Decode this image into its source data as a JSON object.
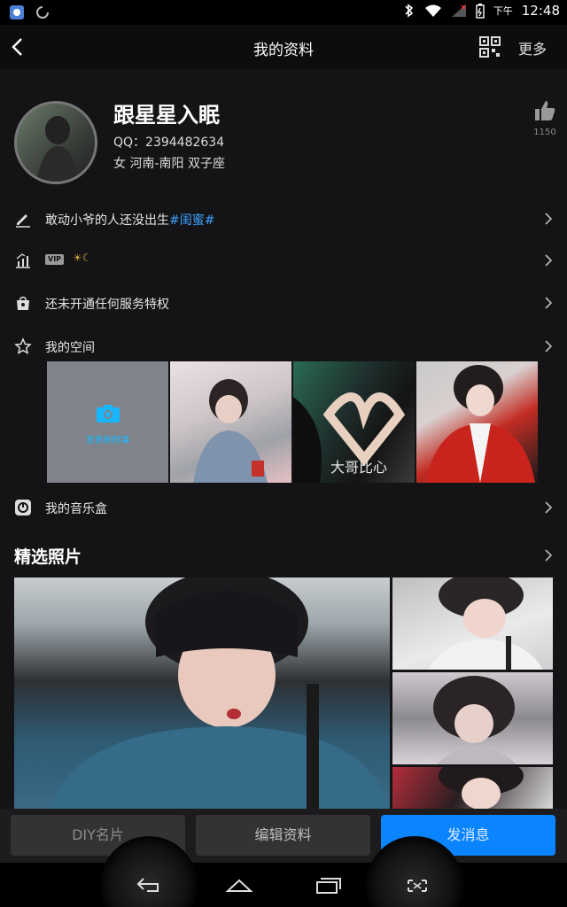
{
  "status_bar": {
    "time": "12:48",
    "ampm": "下午"
  },
  "nav": {
    "title": "我的资料",
    "more_label": "更多"
  },
  "profile": {
    "nickname": "跟星星入眠",
    "qq": "QQ：2394482634",
    "info": "女  河南-南阳  双子座",
    "like_count": "1150"
  },
  "rows": {
    "signature_prefix": "敢动小爷的人还没出生",
    "signature_tag": "#闺蜜#",
    "level_badge": "VIP",
    "level_icons": "☀☾",
    "service": "还未开通任何服务特权",
    "space": "我的空间",
    "music": "我的音乐盒"
  },
  "space": {
    "post_label": "发表新鲜事",
    "tile3_caption": "大哥比心"
  },
  "featured": {
    "title": "精选照片"
  },
  "actions": {
    "diy": "DIY名片",
    "edit": "编辑资料",
    "message": "发消息"
  },
  "colors": {
    "accent": "#0a84ff",
    "link": "#3aa0ff",
    "camera": "#18b7ff"
  }
}
